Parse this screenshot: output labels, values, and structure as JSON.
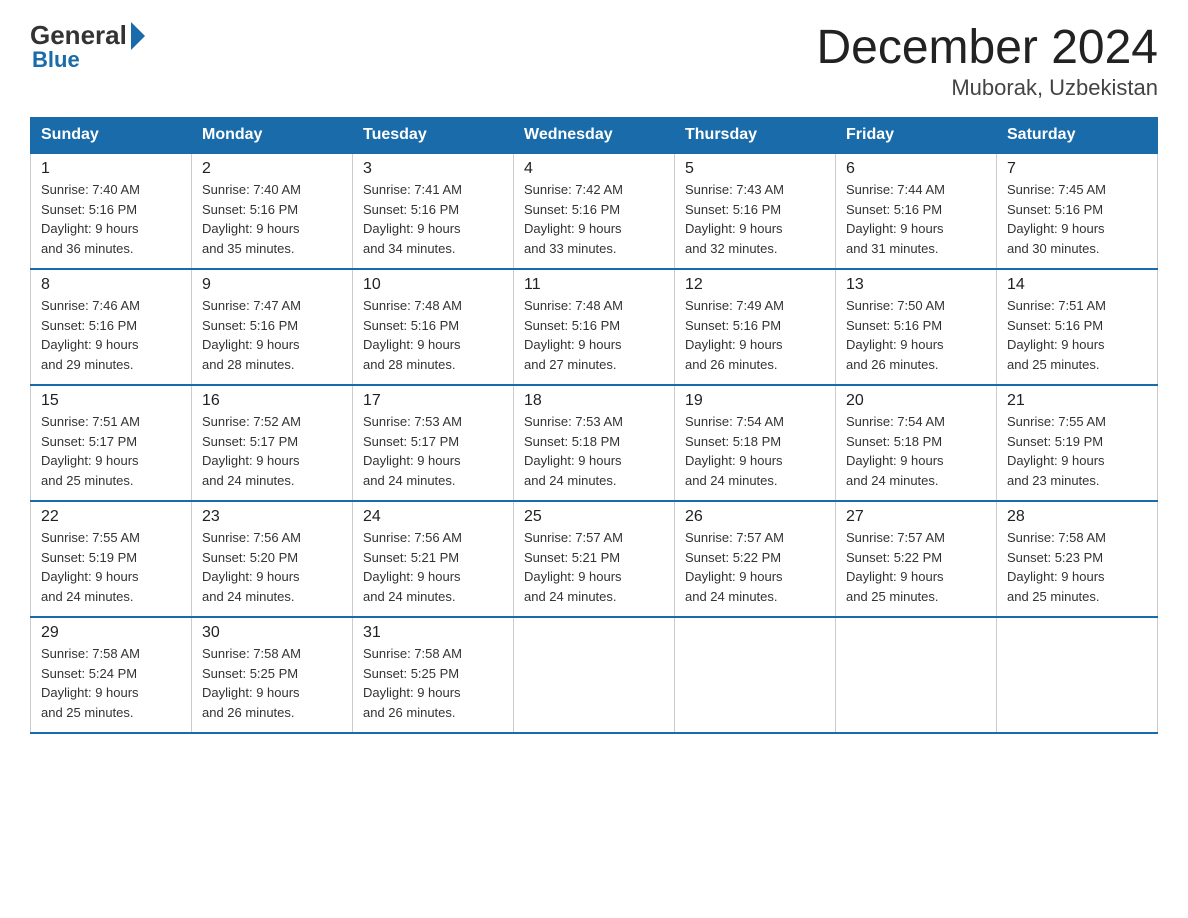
{
  "logo": {
    "general": "General",
    "blue": "Blue"
  },
  "title": "December 2024",
  "subtitle": "Muborak, Uzbekistan",
  "days_of_week": [
    "Sunday",
    "Monday",
    "Tuesday",
    "Wednesday",
    "Thursday",
    "Friday",
    "Saturday"
  ],
  "weeks": [
    [
      {
        "day": "1",
        "sunrise": "7:40 AM",
        "sunset": "5:16 PM",
        "daylight": "9 hours and 36 minutes."
      },
      {
        "day": "2",
        "sunrise": "7:40 AM",
        "sunset": "5:16 PM",
        "daylight": "9 hours and 35 minutes."
      },
      {
        "day": "3",
        "sunrise": "7:41 AM",
        "sunset": "5:16 PM",
        "daylight": "9 hours and 34 minutes."
      },
      {
        "day": "4",
        "sunrise": "7:42 AM",
        "sunset": "5:16 PM",
        "daylight": "9 hours and 33 minutes."
      },
      {
        "day": "5",
        "sunrise": "7:43 AM",
        "sunset": "5:16 PM",
        "daylight": "9 hours and 32 minutes."
      },
      {
        "day": "6",
        "sunrise": "7:44 AM",
        "sunset": "5:16 PM",
        "daylight": "9 hours and 31 minutes."
      },
      {
        "day": "7",
        "sunrise": "7:45 AM",
        "sunset": "5:16 PM",
        "daylight": "9 hours and 30 minutes."
      }
    ],
    [
      {
        "day": "8",
        "sunrise": "7:46 AM",
        "sunset": "5:16 PM",
        "daylight": "9 hours and 29 minutes."
      },
      {
        "day": "9",
        "sunrise": "7:47 AM",
        "sunset": "5:16 PM",
        "daylight": "9 hours and 28 minutes."
      },
      {
        "day": "10",
        "sunrise": "7:48 AM",
        "sunset": "5:16 PM",
        "daylight": "9 hours and 28 minutes."
      },
      {
        "day": "11",
        "sunrise": "7:48 AM",
        "sunset": "5:16 PM",
        "daylight": "9 hours and 27 minutes."
      },
      {
        "day": "12",
        "sunrise": "7:49 AM",
        "sunset": "5:16 PM",
        "daylight": "9 hours and 26 minutes."
      },
      {
        "day": "13",
        "sunrise": "7:50 AM",
        "sunset": "5:16 PM",
        "daylight": "9 hours and 26 minutes."
      },
      {
        "day": "14",
        "sunrise": "7:51 AM",
        "sunset": "5:16 PM",
        "daylight": "9 hours and 25 minutes."
      }
    ],
    [
      {
        "day": "15",
        "sunrise": "7:51 AM",
        "sunset": "5:17 PM",
        "daylight": "9 hours and 25 minutes."
      },
      {
        "day": "16",
        "sunrise": "7:52 AM",
        "sunset": "5:17 PM",
        "daylight": "9 hours and 24 minutes."
      },
      {
        "day": "17",
        "sunrise": "7:53 AM",
        "sunset": "5:17 PM",
        "daylight": "9 hours and 24 minutes."
      },
      {
        "day": "18",
        "sunrise": "7:53 AM",
        "sunset": "5:18 PM",
        "daylight": "9 hours and 24 minutes."
      },
      {
        "day": "19",
        "sunrise": "7:54 AM",
        "sunset": "5:18 PM",
        "daylight": "9 hours and 24 minutes."
      },
      {
        "day": "20",
        "sunrise": "7:54 AM",
        "sunset": "5:18 PM",
        "daylight": "9 hours and 24 minutes."
      },
      {
        "day": "21",
        "sunrise": "7:55 AM",
        "sunset": "5:19 PM",
        "daylight": "9 hours and 23 minutes."
      }
    ],
    [
      {
        "day": "22",
        "sunrise": "7:55 AM",
        "sunset": "5:19 PM",
        "daylight": "9 hours and 24 minutes."
      },
      {
        "day": "23",
        "sunrise": "7:56 AM",
        "sunset": "5:20 PM",
        "daylight": "9 hours and 24 minutes."
      },
      {
        "day": "24",
        "sunrise": "7:56 AM",
        "sunset": "5:21 PM",
        "daylight": "9 hours and 24 minutes."
      },
      {
        "day": "25",
        "sunrise": "7:57 AM",
        "sunset": "5:21 PM",
        "daylight": "9 hours and 24 minutes."
      },
      {
        "day": "26",
        "sunrise": "7:57 AM",
        "sunset": "5:22 PM",
        "daylight": "9 hours and 24 minutes."
      },
      {
        "day": "27",
        "sunrise": "7:57 AM",
        "sunset": "5:22 PM",
        "daylight": "9 hours and 25 minutes."
      },
      {
        "day": "28",
        "sunrise": "7:58 AM",
        "sunset": "5:23 PM",
        "daylight": "9 hours and 25 minutes."
      }
    ],
    [
      {
        "day": "29",
        "sunrise": "7:58 AM",
        "sunset": "5:24 PM",
        "daylight": "9 hours and 25 minutes."
      },
      {
        "day": "30",
        "sunrise": "7:58 AM",
        "sunset": "5:25 PM",
        "daylight": "9 hours and 26 minutes."
      },
      {
        "day": "31",
        "sunrise": "7:58 AM",
        "sunset": "5:25 PM",
        "daylight": "9 hours and 26 minutes."
      },
      null,
      null,
      null,
      null
    ]
  ],
  "labels": {
    "sunrise": "Sunrise:",
    "sunset": "Sunset:",
    "daylight": "Daylight:"
  }
}
